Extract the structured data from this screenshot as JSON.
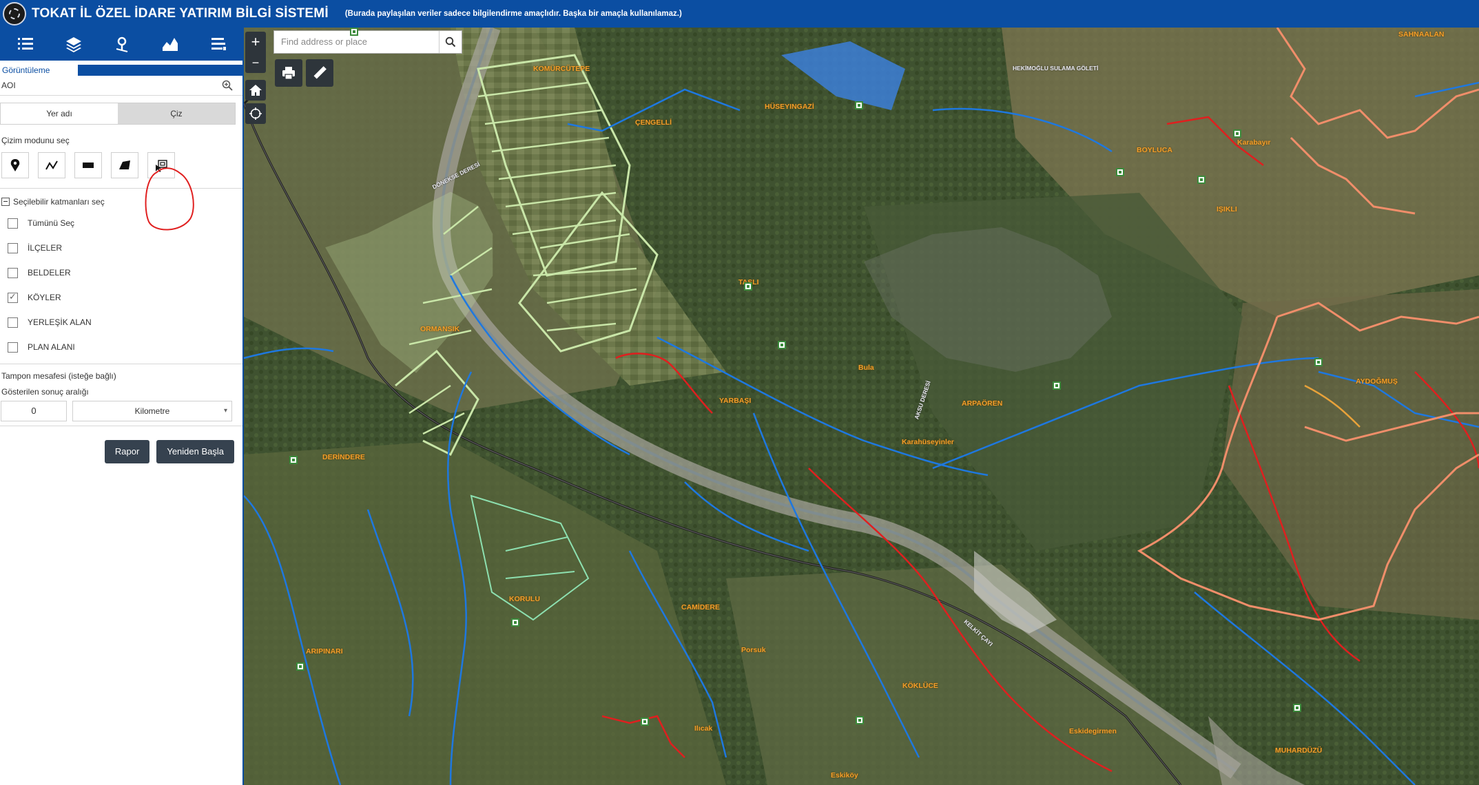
{
  "header": {
    "title": "TOKAT İL ÖZEL İDARE YATIRIM BİLGİ SİSTEMİ",
    "disclaimer": "(Burada paylaşılan veriler sadece bilgilendirme amaçlıdır. Başka bir amaçla kullanılamaz.)"
  },
  "toolbar": {
    "icons": [
      "list-icon",
      "layers-icon",
      "location-pin-icon",
      "chart-icon",
      "menu-icon"
    ]
  },
  "panel": {
    "tab_label": "Görüntüleme",
    "aoi_label": "AOI",
    "tabs": [
      "Yer adı",
      "Çiz"
    ],
    "active_tab": "Çiz",
    "draw_mode_label": "Çizim modunu seç",
    "draw_tools": [
      "point-icon",
      "polyline-icon",
      "rectangle-icon",
      "freehand-polygon-icon",
      "select-extent-icon"
    ],
    "layers_title": "Seçilebilir katmanları seç",
    "layers": [
      {
        "label": "Tümünü Seç",
        "checked": false
      },
      {
        "label": "İLÇELER",
        "checked": false
      },
      {
        "label": "BELDELER",
        "checked": false
      },
      {
        "label": "KÖYLER",
        "checked": true
      },
      {
        "label": "YERLEŞİK ALAN",
        "checked": false
      },
      {
        "label": "PLAN ALANI",
        "checked": false
      }
    ],
    "buffer_label": "Tampon mesafesi (isteğe bağlı)",
    "range_label": "Gösterilen sonuç aralığı",
    "buffer_value": "0",
    "buffer_unit": "Kilometre",
    "report_button": "Rapor",
    "reset_button": "Yeniden Başla"
  },
  "map": {
    "search_placeholder": "Find address or place",
    "zoom_in": "+",
    "zoom_out": "−",
    "labels": [
      "KOMÜRCÜTEPE",
      "ÇENGELLİ",
      "HÜSEYINGAZİ",
      "SAHNAALAN",
      "BOYLUCA",
      "Karabayır",
      "IŞIKLI",
      "DÖNEKSE DERESİ",
      "TAŞLI",
      "ORMANSIK",
      "Bula",
      "YARBAŞI",
      "ARPAÖREN",
      "Karahüseyinler",
      "AYDOĞMUŞ",
      "DERİNDERE",
      "KORULU",
      "CAMİDERE",
      "Porsuk",
      "KÖKLÜCE",
      "ARIPINARI",
      "Ilıcak",
      "Eskidegirmen",
      "MUHARDÜZÜ",
      "Eskiköy",
      "HEKİMOĞLU SULAMA GÖLETİ",
      "AKSU DERESİ",
      "KELKİT ÇAYI"
    ]
  }
}
